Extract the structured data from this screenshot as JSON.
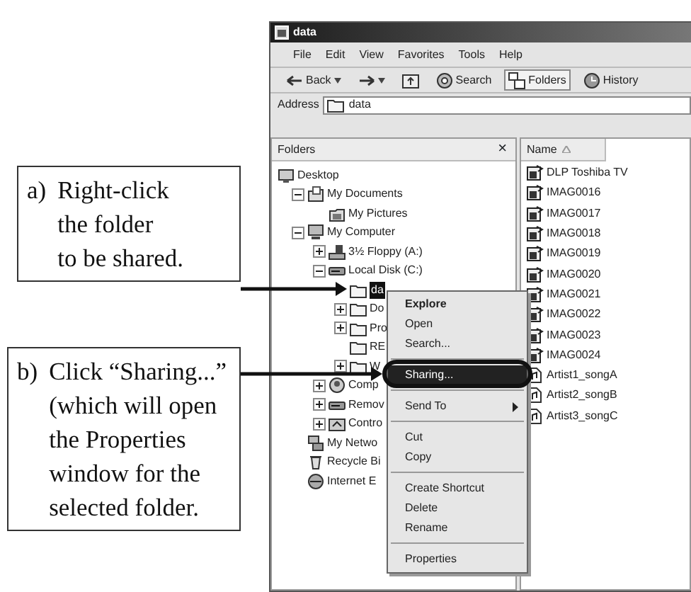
{
  "window": {
    "title": "data"
  },
  "menu_bar": [
    "File",
    "Edit",
    "View",
    "Favorites",
    "Tools",
    "Help"
  ],
  "toolbar": [
    {
      "kind": "back",
      "label": "Back",
      "selected": false
    },
    {
      "kind": "forward",
      "selected": false
    },
    {
      "kind": "up",
      "selected": false
    },
    {
      "kind": "search",
      "label": "Search",
      "selected": false
    },
    {
      "kind": "folders",
      "label": "Folders",
      "selected": true
    },
    {
      "kind": "history",
      "label": "History",
      "selected": false
    }
  ],
  "address": {
    "label": "Address",
    "value": "data"
  },
  "folders_pane": {
    "title": "Folders",
    "close": "×",
    "tree": [
      {
        "label": "Desktop",
        "kind": "desktop",
        "selected": false,
        "children": [
          {
            "label": "My Documents",
            "kind": "documents",
            "expanded": true,
            "selected": false,
            "children": [
              {
                "label": "My Pictures",
                "kind": "pictures",
                "selected": false
              }
            ]
          },
          {
            "label": "My Computer",
            "kind": "computer",
            "expanded": true,
            "selected": false,
            "children": [
              {
                "label": "3½ Floppy (A:)",
                "kind": "floppy",
                "expanded": false,
                "selected": false
              },
              {
                "label": "Local Disk (C:)",
                "kind": "drive",
                "expanded": true,
                "selected": false,
                "children": [
                  {
                    "label": "da",
                    "kind": "folder",
                    "selected": true
                  },
                  {
                    "label": "Do",
                    "kind": "folder",
                    "expanded": false,
                    "selected": false
                  },
                  {
                    "label": "Pro",
                    "kind": "folder",
                    "expanded": false,
                    "selected": false
                  },
                  {
                    "label": "RE",
                    "kind": "folder",
                    "selected": false
                  },
                  {
                    "label": "W",
                    "kind": "folder",
                    "expanded": false,
                    "selected": false
                  }
                ]
              },
              {
                "label": "Comp",
                "kind": "shared",
                "expanded": false,
                "selected": false
              },
              {
                "label": "Remov",
                "kind": "drive",
                "expanded": false,
                "selected": false
              },
              {
                "label": "Contro",
                "kind": "control",
                "expanded": false,
                "selected": false
              }
            ]
          },
          {
            "label": "My Netwo",
            "kind": "network",
            "selected": false
          },
          {
            "label": "Recycle Bi",
            "kind": "recycle",
            "selected": false
          },
          {
            "label": "Internet E",
            "kind": "browser",
            "selected": false
          }
        ]
      }
    ]
  },
  "file_list": {
    "columns": [
      "Name"
    ],
    "rows": [
      {
        "name": "DLP Toshiba TV",
        "kind": "image"
      },
      {
        "name": "IMAG0016",
        "kind": "image"
      },
      {
        "name": "IMAG0017",
        "kind": "image"
      },
      {
        "name": "IMAG0018",
        "kind": "image"
      },
      {
        "name": "IMAG0019",
        "kind": "image"
      },
      {
        "name": "IMAG0020",
        "kind": "image"
      },
      {
        "name": "IMAG0021",
        "kind": "image"
      },
      {
        "name": "IMAG0022",
        "kind": "image"
      },
      {
        "name": "IMAG0023",
        "kind": "image"
      },
      {
        "name": "IMAG0024",
        "kind": "image"
      },
      {
        "name": "Artist1_songA",
        "kind": "audio"
      },
      {
        "name": "Artist2_songB",
        "kind": "audio"
      },
      {
        "name": "Artist3_songC",
        "kind": "audio"
      }
    ]
  },
  "context_menu": {
    "groups": [
      [
        {
          "label": "Explore",
          "default": true,
          "selected": false
        },
        {
          "label": "Open",
          "selected": false
        },
        {
          "label": "Search...",
          "selected": false
        }
      ],
      [
        {
          "label": "Sharing...",
          "selected": true
        }
      ],
      [
        {
          "label": "Send To",
          "submenu": true,
          "selected": false
        }
      ],
      [
        {
          "label": "Cut",
          "selected": false
        },
        {
          "label": "Copy",
          "selected": false
        }
      ],
      [
        {
          "label": "Create Shortcut",
          "selected": false
        },
        {
          "label": "Delete",
          "selected": false
        },
        {
          "label": "Rename",
          "selected": false
        }
      ],
      [
        {
          "label": "Properties",
          "selected": false
        }
      ]
    ]
  },
  "callouts": [
    {
      "marker": "a)",
      "lines": [
        "Right-click",
        "the folder",
        "to be shared."
      ]
    },
    {
      "marker": "b)",
      "lines": [
        "Click “Sharing...”",
        "(which will open",
        "the Properties",
        "window for the",
        "selected folder."
      ]
    }
  ]
}
